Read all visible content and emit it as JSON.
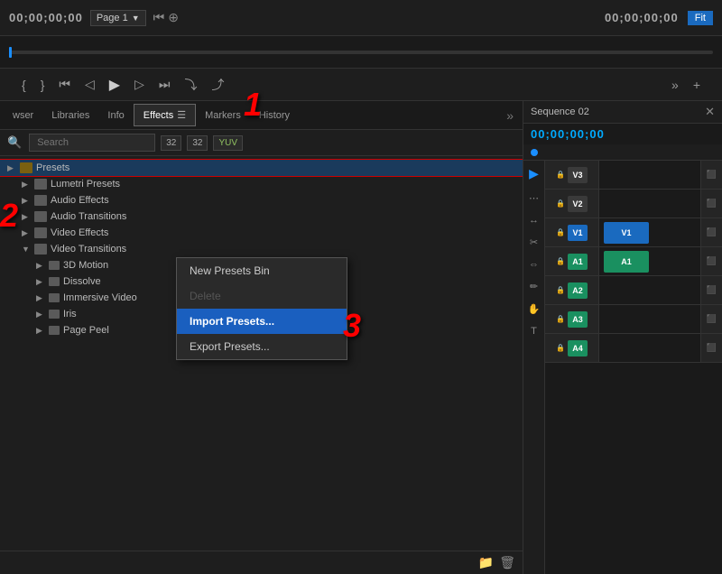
{
  "topbar": {
    "timecode_left": "00;00;00;00",
    "page_label": "Page 1",
    "timecode_right": "00;00;00;00",
    "fit_label": "Fit"
  },
  "tabs": {
    "browser": "wser",
    "libraries": "Libraries",
    "info": "Info",
    "effects": "Effects",
    "markers": "Markers",
    "history": "History",
    "more_icon": "»"
  },
  "search": {
    "placeholder": "Search"
  },
  "tree": {
    "items": [
      {
        "id": "presets",
        "label": "Presets",
        "indent": 0,
        "expanded": false,
        "selected": true
      },
      {
        "id": "lumetri",
        "label": "Lumetri Presets",
        "indent": 1,
        "expanded": false
      },
      {
        "id": "audio-effects",
        "label": "Audio Effects",
        "indent": 1,
        "expanded": false
      },
      {
        "id": "audio-transitions",
        "label": "Audio Transitions",
        "indent": 1,
        "expanded": false
      },
      {
        "id": "video-effects",
        "label": "Video Effects",
        "indent": 1,
        "expanded": false
      },
      {
        "id": "video-transitions",
        "label": "Video Transitions",
        "indent": 1,
        "expanded": true
      },
      {
        "id": "3d-motion",
        "label": "3D Motion",
        "indent": 2,
        "expanded": false
      },
      {
        "id": "dissolve",
        "label": "Dissolve",
        "indent": 2,
        "expanded": false
      },
      {
        "id": "immersive-video",
        "label": "Immersive Video",
        "indent": 2,
        "expanded": false
      },
      {
        "id": "iris",
        "label": "Iris",
        "indent": 2,
        "expanded": false
      },
      {
        "id": "page-peel",
        "label": "Page Peel",
        "indent": 2,
        "expanded": false
      }
    ]
  },
  "context_menu": {
    "new_presets_bin": "New Presets Bin",
    "delete": "Delete",
    "import_presets": "Import Presets...",
    "export_presets": "Export Presets..."
  },
  "sequence": {
    "title": "Sequence 02",
    "timecode": "00;00;00;00"
  },
  "tracks": [
    {
      "id": "v3",
      "label": "V3",
      "badge_class": "badge-v3",
      "has_clip": false
    },
    {
      "id": "v2",
      "label": "V2",
      "badge_class": "badge-v2",
      "has_clip": false
    },
    {
      "id": "v1",
      "label": "V1",
      "badge_class": "badge-v1",
      "has_clip": true,
      "clip_color": "#1a6abf"
    },
    {
      "id": "a1",
      "label": "A1",
      "badge_class": "badge-a1",
      "has_clip": true,
      "clip_color": "#1a9060"
    },
    {
      "id": "a2",
      "label": "A2",
      "badge_class": "badge-a2",
      "has_clip": false
    },
    {
      "id": "a3",
      "label": "A3",
      "badge_class": "badge-a3",
      "has_clip": false
    },
    {
      "id": "a4",
      "label": "A4",
      "badge_class": "badge-a4",
      "has_clip": false
    }
  ],
  "annotations": {
    "num1": "1",
    "num2": "2",
    "num3": "3"
  }
}
